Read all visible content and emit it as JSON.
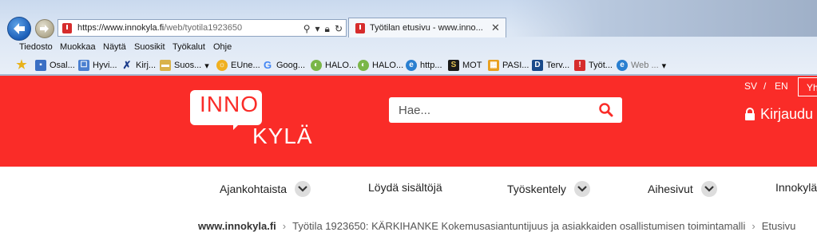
{
  "browser": {
    "url_host": "https://www.innokyla.fi",
    "url_path": "/web/tyotila1923650",
    "tab_title": "Työtilan etusivu - www.inno...",
    "menu": [
      "Tiedosto",
      "Muokkaa",
      "Näytä",
      "Suosikit",
      "Työkalut",
      "Ohje"
    ],
    "favorites": [
      "Osal...",
      "Hyvi...",
      "Kirj...",
      "Suos...",
      "EUne...",
      "Goog...",
      "HALO...",
      "HALO...",
      "http...",
      "MOT",
      "PASI...",
      "Terv...",
      "Työt...",
      "Web ..."
    ]
  },
  "header": {
    "logo_top": "INNO",
    "logo_bottom": "KYLÄ",
    "search_placeholder": "Hae...",
    "lang_sv": "SV",
    "lang_sep": "/",
    "lang_en": "EN",
    "yht_label": "Yh",
    "login_label": "Kirjaudu"
  },
  "nav": {
    "items": [
      "Ajankohtaista",
      "Löydä sisältöjä",
      "Työskentely",
      "Aihesivut",
      "Innokylä"
    ]
  },
  "breadcrumb": {
    "home": "www.innokyla.fi",
    "current": "Työtila 1923650: KÄRKIHANKE Kokemusasiantuntijuus ja asiakkaiden osallistumisen toimintamalli",
    "last": "Etusivu"
  },
  "colors": {
    "brand_red": "#fa2c28"
  }
}
